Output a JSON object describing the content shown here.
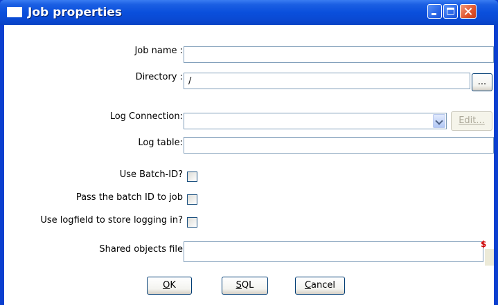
{
  "window": {
    "title": "Job properties",
    "controls": [
      "minimize",
      "maximize",
      "close"
    ]
  },
  "form": {
    "job_name": {
      "label": "Job name :",
      "value": ""
    },
    "directory": {
      "label": "Directory :",
      "value": "/",
      "browse_label": "..."
    },
    "log_connection": {
      "label": "Log Connection:",
      "value": "",
      "edit_label": "Edit..."
    },
    "log_table": {
      "label": "Log table:",
      "value": ""
    },
    "use_batch_id": {
      "label": "Use Batch-ID?",
      "checked": false
    },
    "pass_batch_id": {
      "label": "Pass the batch ID to job",
      "checked": false
    },
    "use_logfield": {
      "label": "Use logfield to store logging in?",
      "checked": false
    },
    "shared_objects": {
      "label": "Shared objects file",
      "value": "",
      "variable_icon": "$"
    }
  },
  "buttons": {
    "ok": {
      "first": "O",
      "rest": "K"
    },
    "sql": {
      "first": "S",
      "rest": "QL"
    },
    "cancel": {
      "first": "C",
      "rest": "ancel"
    }
  },
  "colors": {
    "titlebar": "#0a4fdc",
    "close_button": "#e0542c",
    "field_border": "#7f9db9",
    "variable_icon": "#d40000"
  }
}
